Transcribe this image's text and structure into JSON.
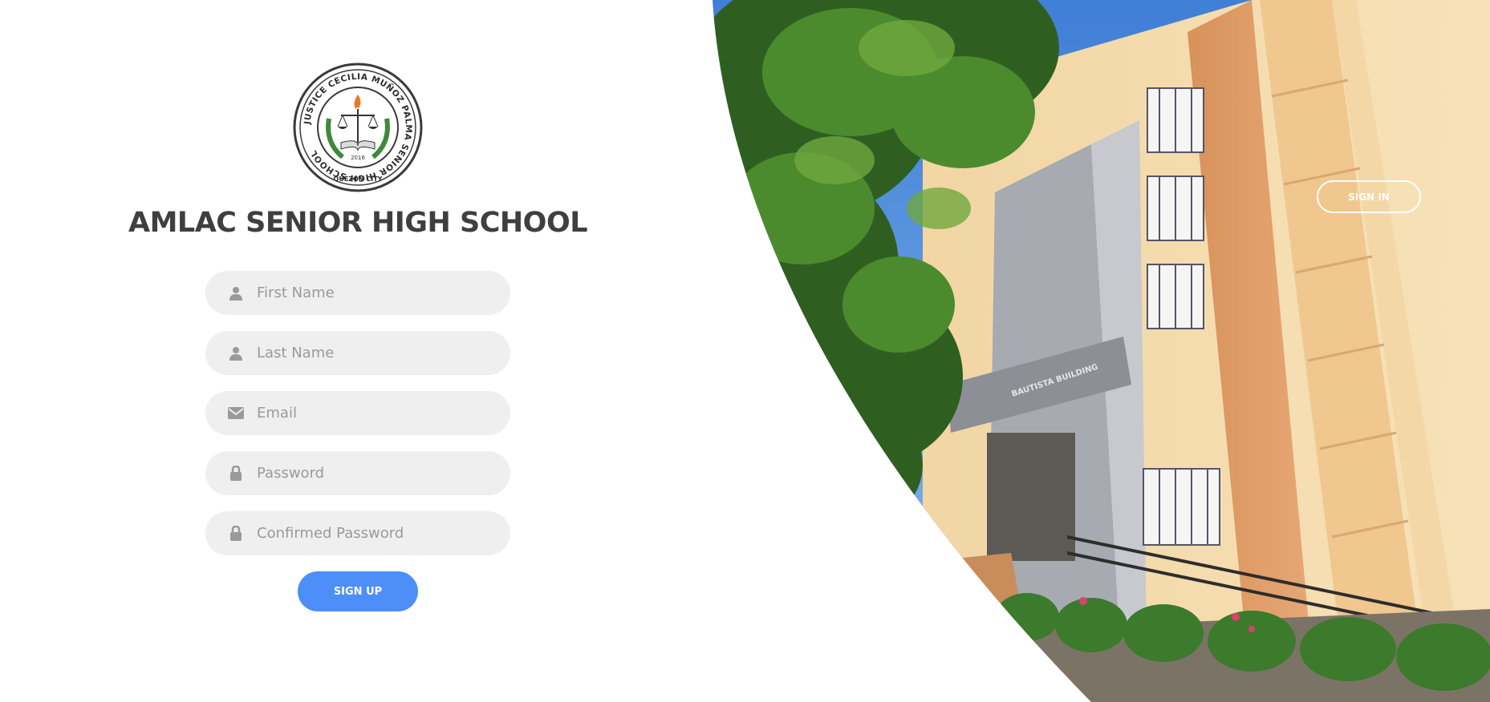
{
  "school": {
    "title": "AMLAC SENIOR HIGH SCHOOL",
    "logo_ring_text": "JUSTICE CECILIA MUÑOZ PALMA SENIOR HIGH SCHOOL",
    "logo_bottom_text": "QUEZON CITY",
    "logo_year": "2016"
  },
  "form": {
    "first_name": {
      "placeholder": "First Name",
      "icon": "user-icon"
    },
    "last_name": {
      "placeholder": "Last Name",
      "icon": "user-icon"
    },
    "email": {
      "placeholder": "Email",
      "icon": "envelope-icon"
    },
    "password": {
      "placeholder": "Password",
      "icon": "lock-icon"
    },
    "confirm_password": {
      "placeholder": "Confirmed Password",
      "icon": "lock-icon"
    },
    "signup_label": "SIGN UP"
  },
  "panel": {
    "signin_label": "SIGN IN",
    "building_sign": "BAUTISTA BUILDING"
  },
  "colors": {
    "accent": "#4d8ef8",
    "field_bg": "#efefef",
    "title": "#3f3f3f",
    "placeholder": "#9a9a9a"
  }
}
